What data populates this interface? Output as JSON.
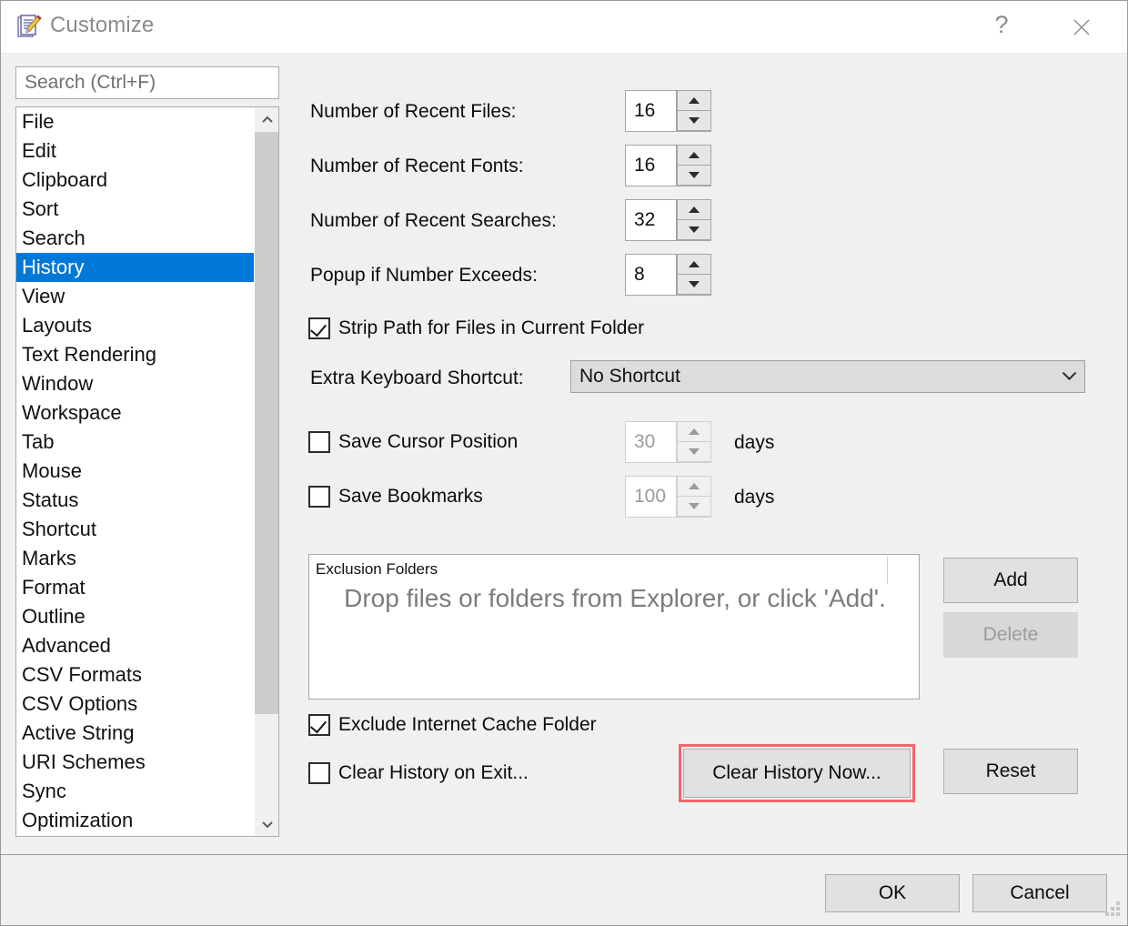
{
  "window": {
    "title": "Customize",
    "icon": "notepad-pencil-icon",
    "help_label": "?",
    "close_label": "✕"
  },
  "sidebar": {
    "search": {
      "placeholder": "Search (Ctrl+F)",
      "value": ""
    },
    "items": [
      "File",
      "Edit",
      "Clipboard",
      "Sort",
      "Search",
      "History",
      "View",
      "Layouts",
      "Text Rendering",
      "Window",
      "Workspace",
      "Tab",
      "Mouse",
      "Status",
      "Shortcut",
      "Marks",
      "Format",
      "Outline",
      "Advanced",
      "CSV Formats",
      "CSV Options",
      "Active String",
      "URI Schemes",
      "Sync",
      "Optimization"
    ],
    "selected": "History",
    "scroll_up_glyph": "⌃",
    "scroll_down_glyph": "⌄"
  },
  "main": {
    "spin_rows": [
      {
        "label": "Number of Recent Files:",
        "value": "16",
        "disabled": false
      },
      {
        "label": "Number of Recent Fonts:",
        "value": "16",
        "disabled": false
      },
      {
        "label": "Number of Recent Searches:",
        "value": "32",
        "disabled": false
      },
      {
        "label": "Popup if Number Exceeds:",
        "value": "8",
        "disabled": false
      }
    ],
    "strip_path": {
      "label": "Strip Path for Files in Current Folder",
      "checked": true
    },
    "shortcut": {
      "label": "Extra Keyboard Shortcut:",
      "selected": "No Shortcut",
      "options": [
        "No Shortcut"
      ]
    },
    "save_cursor": {
      "label": "Save Cursor Position",
      "checked": false,
      "days_value": "30",
      "days_unit": "days",
      "disabled": true
    },
    "save_bookmarks": {
      "label": "Save Bookmarks",
      "checked": false,
      "days_value": "100",
      "days_unit": "days",
      "disabled": true
    },
    "exclusion": {
      "header": "Exclusion Folders",
      "placeholder": "Drop files or folders from Explorer, or click 'Add'.",
      "add_label": "Add",
      "delete_label": "Delete",
      "delete_disabled": true
    },
    "exclude_cache": {
      "label": "Exclude Internet Cache Folder",
      "checked": true
    },
    "clear_on_exit": {
      "label": "Clear History on Exit...",
      "checked": false
    },
    "clear_now_label": "Clear History Now...",
    "reset_label": "Reset"
  },
  "footer": {
    "ok_label": "OK",
    "cancel_label": "Cancel"
  },
  "colors": {
    "accent": "#0078d7",
    "annotation": "#f4666c",
    "dialog_bg": "#f0f0f0",
    "button_bg": "#e1e1e1"
  }
}
